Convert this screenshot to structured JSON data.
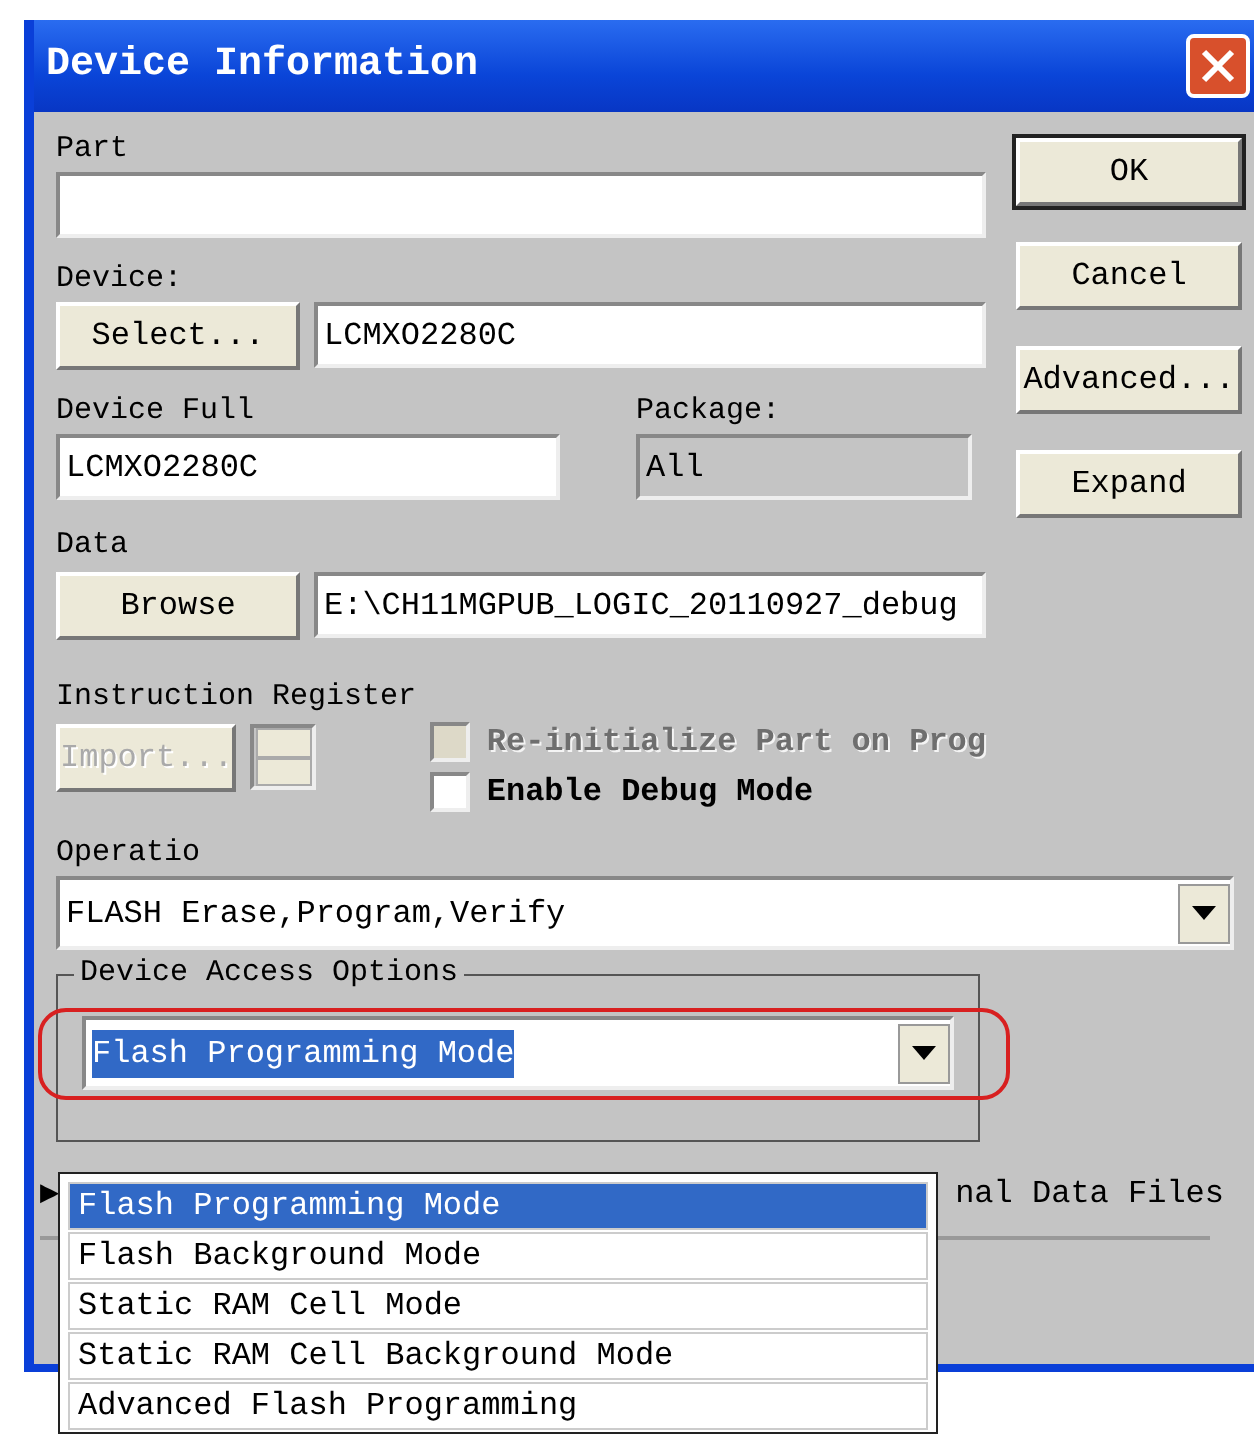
{
  "window": {
    "title": "Device Information"
  },
  "part": {
    "label": "Part"
  },
  "device": {
    "label": "Device:",
    "button": "Select...",
    "value": "LCMXO2280C"
  },
  "device_full": {
    "label": "Device Full",
    "value": "LCMXO2280C"
  },
  "package": {
    "label": "Package:",
    "value": "All"
  },
  "data": {
    "label": "Data",
    "button": "Browse",
    "value": "E:\\CH11MGPUB_LOGIC_20110927_debug"
  },
  "instruction_register": {
    "label": "Instruction Register",
    "button": "Import...",
    "disabled": true
  },
  "checkboxes": [
    {
      "label": "Re-initialize Part on Prog",
      "checked": false,
      "disabled": true
    },
    {
      "label": "Enable Debug Mode",
      "checked": false,
      "disabled": false
    }
  ],
  "operation": {
    "label": "Operatio",
    "value": "FLASH Erase,Program,Verify"
  },
  "device_access": {
    "title": "Device Access Options",
    "value": "Flash Programming Mode",
    "highlighted": true,
    "expanded": true,
    "options": [
      {
        "label": "Flash Programming Mode",
        "selected": true
      },
      {
        "label": "Flash Background Mode",
        "selected": false
      },
      {
        "label": "Static RAM Cell Mode",
        "selected": false
      },
      {
        "label": "Static RAM Cell Background Mode",
        "selected": false
      },
      {
        "label": "Advanced Flash Programming",
        "selected": false
      }
    ]
  },
  "external_data": {
    "arrow": "▶",
    "label": "nal Data Files"
  },
  "buttons": [
    {
      "label": "OK",
      "default": true
    },
    {
      "label": "Cancel",
      "default": false
    },
    {
      "label": "Advanced...",
      "default": false
    },
    {
      "label": "Expand",
      "default": false
    }
  ]
}
